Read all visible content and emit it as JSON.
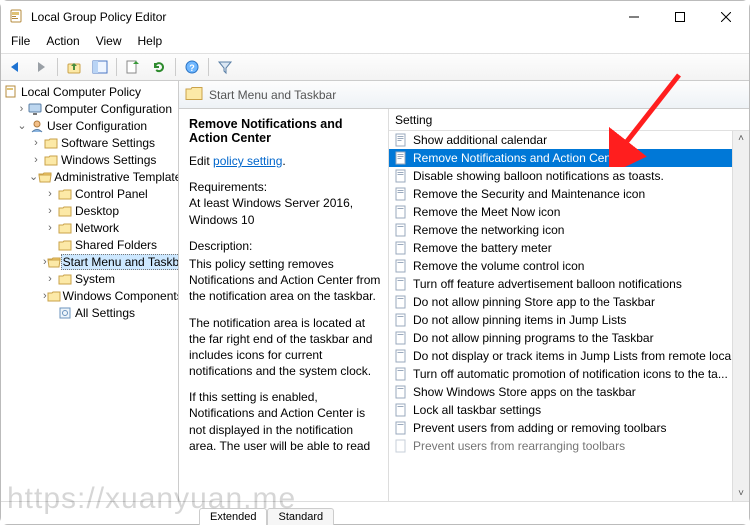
{
  "title": "Local Group Policy Editor",
  "menu": {
    "file": "File",
    "action": "Action",
    "view": "View",
    "help": "Help"
  },
  "tree": {
    "root": "Local Computer Policy",
    "computer_config": "Computer Configuration",
    "user_config": "User Configuration",
    "software_settings": "Software Settings",
    "windows_settings": "Windows Settings",
    "admin_templates": "Administrative Templates",
    "control_panel": "Control Panel",
    "desktop": "Desktop",
    "network": "Network",
    "shared_folders": "Shared Folders",
    "start_menu_taskbar": "Start Menu and Taskbar",
    "system": "System",
    "windows_components": "Windows Components",
    "all_settings": "All Settings"
  },
  "path_heading": "Start Menu and Taskbar",
  "detail": {
    "title": "Remove Notifications and Action Center",
    "edit_prefix": "Edit",
    "edit_link": "policy setting",
    "req_label": "Requirements:",
    "req_body": "At least Windows Server 2016, Windows 10",
    "desc_label": "Description:",
    "desc_p1": "This policy setting removes Notifications and Action Center from the notification area on the taskbar.",
    "desc_p2": "The notification area is located at the far right end of the taskbar and includes icons for current notifications and the system clock.",
    "desc_p3": "If this setting is enabled, Notifications and Action Center is not displayed in the notification area. The user will be able to read"
  },
  "column_header": "Setting",
  "settings": {
    "s0": "Show additional calendar",
    "s1": "Remove Notifications and Action Center",
    "s2": "Disable showing balloon notifications as toasts.",
    "s3": "Remove the Security and Maintenance icon",
    "s4": "Remove the Meet Now icon",
    "s5": "Remove the networking icon",
    "s6": "Remove the battery meter",
    "s7": "Remove the volume control icon",
    "s8": "Turn off feature advertisement balloon notifications",
    "s9": "Do not allow pinning Store app to the Taskbar",
    "s10": "Do not allow pinning items in Jump Lists",
    "s11": "Do not allow pinning programs to the Taskbar",
    "s12": "Do not display or track items in Jump Lists from remote loca...",
    "s13": "Turn off automatic promotion of notification icons to the ta...",
    "s14": "Show Windows Store apps on the taskbar",
    "s15": "Lock all taskbar settings",
    "s16": "Prevent users from adding or removing toolbars",
    "s17": "Prevent users from rearranging toolbars"
  },
  "tabs": {
    "extended": "Extended",
    "standard": "Standard"
  },
  "watermark": "https://xuanyuan.me"
}
